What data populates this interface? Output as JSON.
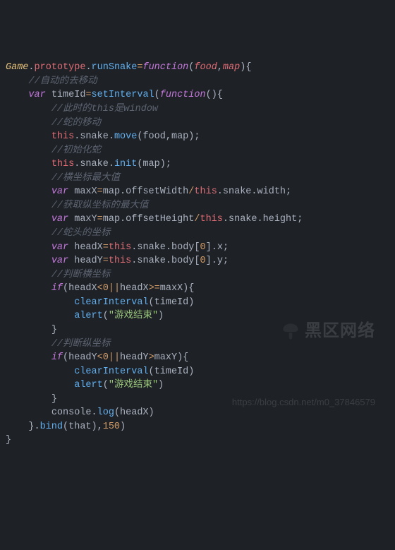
{
  "code": {
    "t_Game": "Game",
    "t_prototype": "prototype",
    "t_runSnake": "runSnake",
    "t_function": "function",
    "t_food": "food",
    "t_map": "map",
    "c_auto_move": "//自动的去移动",
    "t_var": "var",
    "t_timeId": "timeId",
    "t_setInterval": "setInterval",
    "c_this_window": "//此时的this是window",
    "c_snake_move": "//蛇的移动",
    "t_this": "this",
    "t_snake": "snake",
    "t_move": "move",
    "c_init_snake": "//初始化蛇",
    "t_init": "init",
    "c_maxX": "//横坐标最大值",
    "t_maxX": "maxX",
    "t_offsetWidth": "offsetWidth",
    "t_width": "width",
    "c_maxY": "//获取纵坐标的最大值",
    "t_maxY": "maxY",
    "t_offsetHeight": "offsetHeight",
    "t_height": "height",
    "c_head": "//蛇头的坐标",
    "t_headX": "headX",
    "t_headY": "headY",
    "t_body": "body",
    "t_x": "x",
    "t_y": "y",
    "c_judgeX": "//判断横坐标",
    "t_if": "if",
    "t_clearInterval": "clearInterval",
    "t_alert": "alert",
    "s_gameover": "\"游戏结束\"",
    "c_judgeY": "//判断纵坐标",
    "t_console": "console",
    "t_log": "log",
    "t_bind": "bind",
    "t_that": "that",
    "n_0": "0",
    "n_150": "150"
  },
  "watermark": {
    "brand": "黑区网络",
    "url": "https://blog.csdn.net/m0_37846579"
  }
}
